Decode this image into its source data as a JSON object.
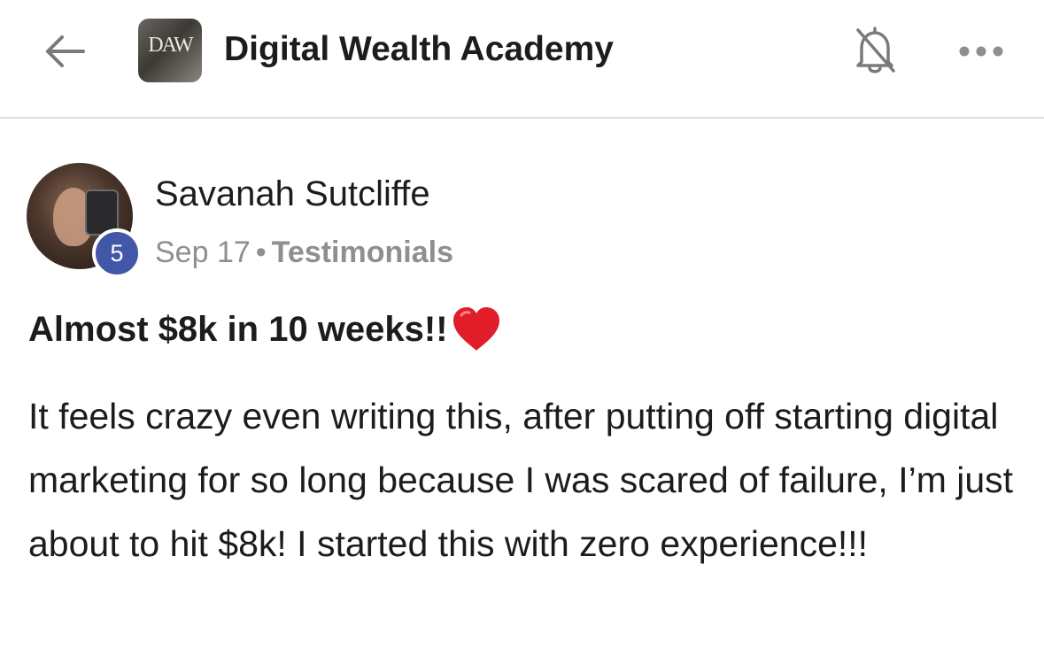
{
  "header": {
    "back_icon": "arrow-left-icon",
    "group_logo_text": "DAW",
    "group_name": "Digital Wealth Academy",
    "bell_icon": "bell-muted-icon",
    "more_icon": "more-horizontal-icon"
  },
  "post": {
    "author": {
      "name": "Savanah Sutcliffe",
      "level": "5",
      "badge_color": "#4357a8"
    },
    "date": "Sep 17",
    "separator": "•",
    "category": "Testimonials",
    "title": "Almost $8k in 10 weeks!!",
    "title_emoji": "heart-icon",
    "body": "It feels crazy even writing this, after putting off starting digital marketing for so long because I was scared of failure, I’m just about to hit $8k! I started this with zero experience!!!"
  }
}
